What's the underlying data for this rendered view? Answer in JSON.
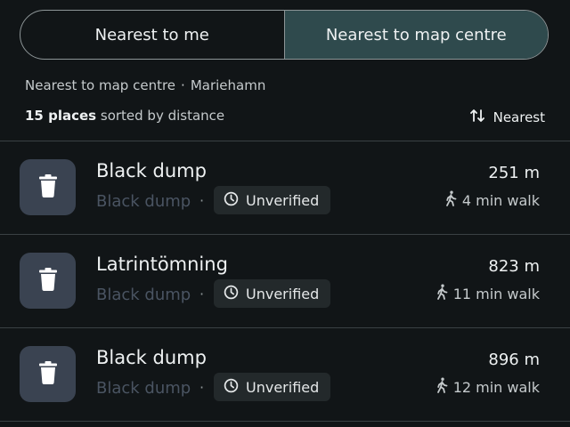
{
  "toggle": {
    "left_label": "Nearest to me",
    "right_label": "Nearest to map centre",
    "active": "right"
  },
  "context": {
    "mode": "Nearest to map centre",
    "separator": "·",
    "location": "Mariehamn"
  },
  "summary": {
    "count_text": "15 places",
    "suffix": "sorted by distance"
  },
  "sort": {
    "label": "Nearest",
    "icon": "sort-arrows-icon"
  },
  "places": [
    {
      "name": "Black dump",
      "category": "Black dump",
      "separator": "·",
      "status": "Unverified",
      "distance": "251 m",
      "walk": "4 min walk"
    },
    {
      "name": "Latrintömning",
      "category": "Black dump",
      "separator": "·",
      "status": "Unverified",
      "distance": "823 m",
      "walk": "11 min walk"
    },
    {
      "name": "Black dump",
      "category": "Black dump",
      "separator": "·",
      "status": "Unverified",
      "distance": "896 m",
      "walk": "12 min walk"
    }
  ],
  "colors": {
    "background": "#111517",
    "active_segment": "#2f4a4d",
    "icon_tile": "#3a4351",
    "badge": "#23292b"
  }
}
